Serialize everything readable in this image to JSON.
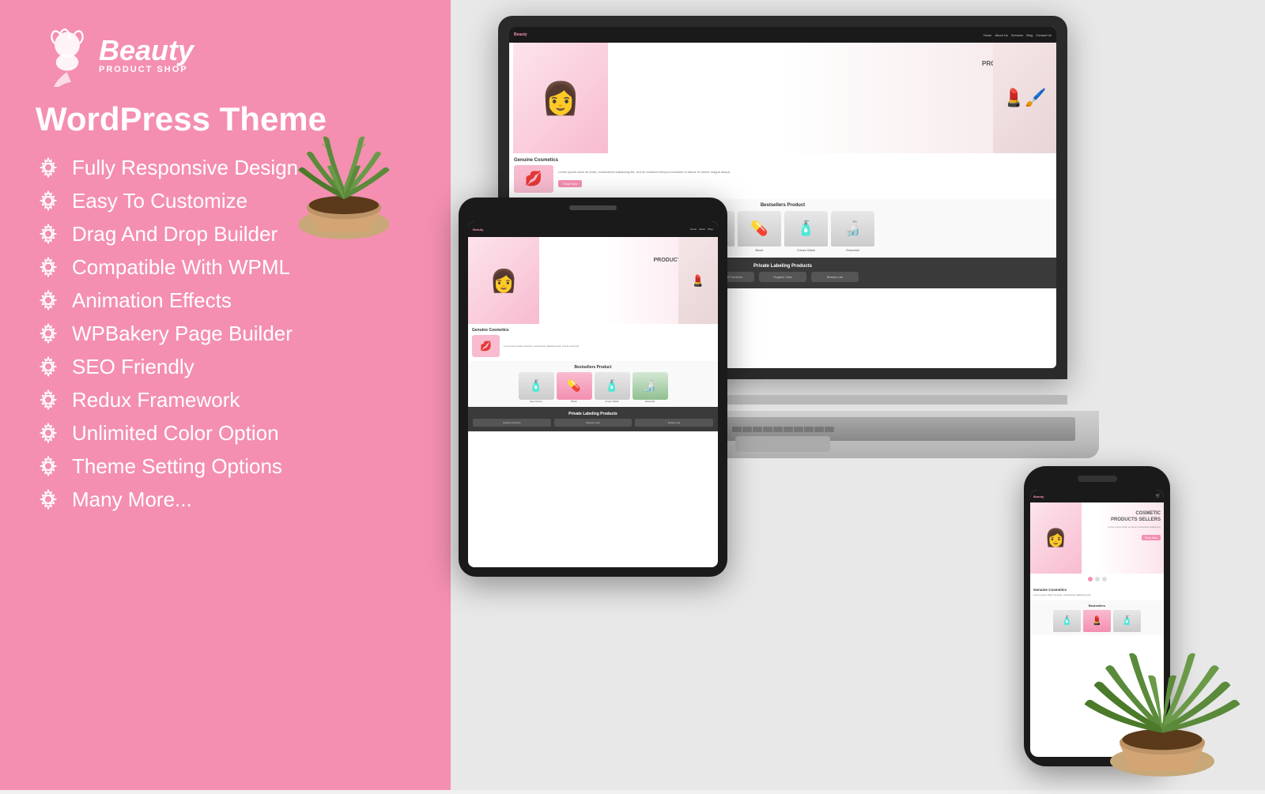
{
  "brand": {
    "name": "Beauty",
    "subtitle": "PRODUCT SHOP",
    "tagline": "WordPress Theme"
  },
  "features": [
    {
      "id": 1,
      "label": "Fully Responsive Design"
    },
    {
      "id": 2,
      "label": "Easy To Customize"
    },
    {
      "id": 3,
      "label": "Drag And Drop Builder"
    },
    {
      "id": 4,
      "label": "Compatible With WPML"
    },
    {
      "id": 5,
      "label": "Animation Effects"
    },
    {
      "id": 6,
      "label": "WPBakery Page Builder"
    },
    {
      "id": 7,
      "label": "SEO Friendly"
    },
    {
      "id": 8,
      "label": "Redux Framework"
    },
    {
      "id": 9,
      "label": "Unlimited Color Option"
    },
    {
      "id": 10,
      "label": "Theme Setting Options"
    },
    {
      "id": 11,
      "label": "Many More..."
    }
  ],
  "colors": {
    "pink": "#f48fb1",
    "dark": "#1a1a1a",
    "light_bg": "#e8e8e8"
  },
  "mock_website": {
    "title": "COSMETIC\nPRODUCTS SELLERS",
    "section": "Genuine Cosmetics",
    "products_title": "Bestsellers Product",
    "dark_section": "Private Labeling Products"
  }
}
